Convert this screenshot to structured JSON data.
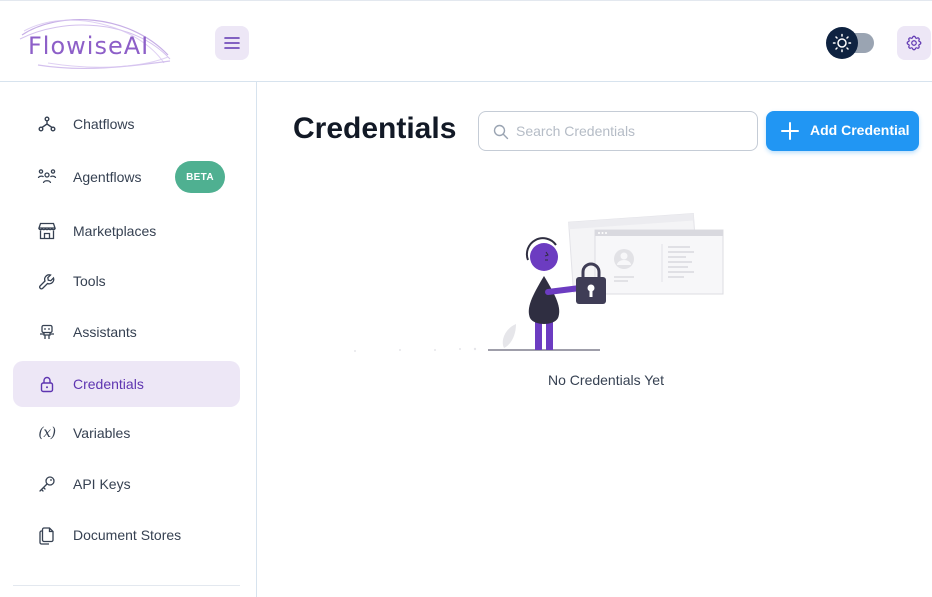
{
  "header": {
    "logo_text": "FlowiseAI"
  },
  "sidebar": {
    "items": [
      {
        "label": "Chatflows",
        "icon": "hierarchy-icon"
      },
      {
        "label": "Agentflows",
        "icon": "users-group-icon",
        "badge": "BETA"
      },
      {
        "label": "Marketplaces",
        "icon": "building-store-icon"
      },
      {
        "label": "Tools",
        "icon": "tool-icon"
      },
      {
        "label": "Assistants",
        "icon": "robot-icon"
      },
      {
        "label": "Credentials",
        "icon": "lock-icon",
        "active": true
      },
      {
        "label": "Variables",
        "icon": "variable-icon",
        "icon_text": "(x)"
      },
      {
        "label": "API Keys",
        "icon": "key-icon"
      },
      {
        "label": "Document Stores",
        "icon": "files-icon"
      }
    ]
  },
  "main": {
    "title": "Credentials",
    "search_placeholder": "Search Credentials",
    "add_button_label": "Add Credential",
    "empty_text": "No Credentials Yet"
  },
  "colors": {
    "accent": "#5e35b1",
    "accent_light": "#ede7f6",
    "primary_button": "#2196f3",
    "beta_badge": "#4fb091",
    "toggle_knob": "#0e2240"
  }
}
